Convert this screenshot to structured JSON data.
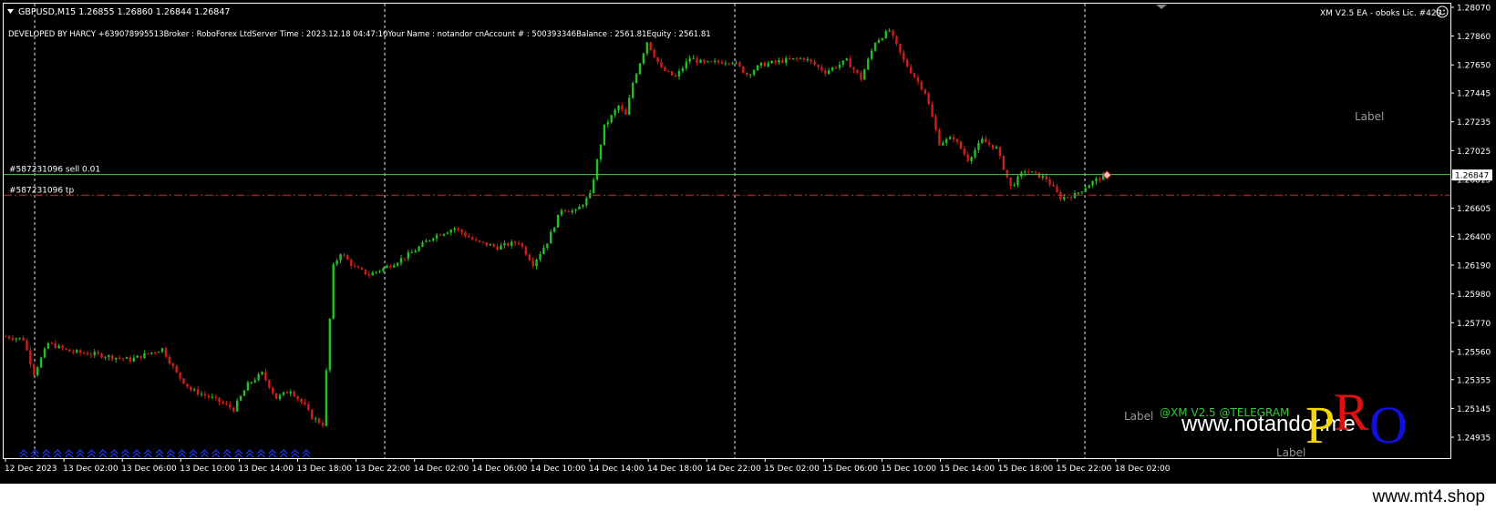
{
  "header": {
    "symbol_line": "GBPUSD,M15  1.26855 1.26860 1.26844 1.26847",
    "info_line": "DEVELOPED BY HARCY +639078995513Broker   : RoboForex LtdServer Time : 2023.12.18 04:47:10Your Name     : notandor cnAccount #   : 500393346Balance : 2561.81Equity     : 2561.81",
    "ea_label": "XM V2.5 EA - oboks Lic. #429"
  },
  "chart_labels": {
    "label1": "Label",
    "label2": "Label",
    "label3": "Label",
    "telegram": "@XM V2.5 @TELEGRAM",
    "website": "www.notandor.me",
    "logo_p": "P",
    "logo_r": "R",
    "logo_o": "O"
  },
  "orders": {
    "sell_label": "#587231096 sell 0.01",
    "tp_label": "#587231096 tp"
  },
  "footer": {
    "url": "www.mt4.shop"
  },
  "colors": {
    "background": "#000000",
    "bull": "#21c121",
    "bear": "#d41a1a",
    "grid": "#ffffff",
    "order_line": "#5fbf5f",
    "tp_line": "#c23030",
    "arrows": "#1e3cff"
  },
  "chart_data": {
    "type": "candlestick",
    "symbol": "GBPUSD",
    "timeframe": "M15",
    "current_price": "1.26847",
    "yticks": [
      "1.28070",
      "1.27860",
      "1.27650",
      "1.27445",
      "1.27235",
      "1.27025",
      "1.26815",
      "1.26605",
      "1.26400",
      "1.26190",
      "1.25980",
      "1.25770",
      "1.25560",
      "1.25355",
      "1.25145",
      "1.24935"
    ],
    "ylim": [
      1.24935,
      1.2807
    ],
    "xticks": [
      "12 Dec 2023",
      "13 Dec 02:00",
      "13 Dec 06:00",
      "13 Dec 10:00",
      "13 Dec 14:00",
      "13 Dec 18:00",
      "13 Dec 22:00",
      "14 Dec 02:00",
      "14 Dec 06:00",
      "14 Dec 10:00",
      "14 Dec 14:00",
      "14 Dec 18:00",
      "14 Dec 22:00",
      "15 Dec 02:00",
      "15 Dec 06:00",
      "15 Dec 10:00",
      "15 Dec 14:00",
      "15 Dec 18:00",
      "15 Dec 22:00",
      "18 Dec 02:00"
    ],
    "sell_price": 1.2685,
    "tp_price": 1.267,
    "close_path": [
      [
        0,
        1.2567
      ],
      [
        5,
        1.2565
      ],
      [
        8,
        1.254
      ],
      [
        12,
        1.2562
      ],
      [
        18,
        1.2556
      ],
      [
        25,
        1.2554
      ],
      [
        35,
        1.255
      ],
      [
        44,
        1.2558
      ],
      [
        48,
        1.254
      ],
      [
        52,
        1.2528
      ],
      [
        58,
        1.2522
      ],
      [
        64,
        1.2514
      ],
      [
        68,
        1.2532
      ],
      [
        72,
        1.254
      ],
      [
        76,
        1.2522
      ],
      [
        80,
        1.2528
      ],
      [
        84,
        1.2516
      ],
      [
        86,
        1.2508
      ],
      [
        89,
        1.2503
      ],
      [
        92,
        1.2618
      ],
      [
        94,
        1.2628
      ],
      [
        98,
        1.2617
      ],
      [
        102,
        1.2612
      ],
      [
        108,
        1.2619
      ],
      [
        114,
        1.2628
      ],
      [
        120,
        1.264
      ],
      [
        126,
        1.2646
      ],
      [
        132,
        1.2636
      ],
      [
        138,
        1.2632
      ],
      [
        144,
        1.2636
      ],
      [
        148,
        1.262
      ],
      [
        152,
        1.2636
      ],
      [
        156,
        1.266
      ],
      [
        160,
        1.2658
      ],
      [
        164,
        1.267
      ],
      [
        168,
        1.272
      ],
      [
        172,
        1.2735
      ],
      [
        174,
        1.2728
      ],
      [
        176,
        1.2752
      ],
      [
        180,
        1.2782
      ],
      [
        184,
        1.2762
      ],
      [
        188,
        1.2756
      ],
      [
        192,
        1.277
      ],
      [
        196,
        1.2766
      ],
      [
        204,
        1.2768
      ],
      [
        208,
        1.2758
      ],
      [
        212,
        1.2765
      ],
      [
        218,
        1.2768
      ],
      [
        224,
        1.277
      ],
      [
        230,
        1.276
      ],
      [
        236,
        1.2768
      ],
      [
        240,
        1.2755
      ],
      [
        244,
        1.2782
      ],
      [
        248,
        1.279
      ],
      [
        252,
        1.2768
      ],
      [
        258,
        1.2745
      ],
      [
        262,
        1.2708
      ],
      [
        266,
        1.2712
      ],
      [
        270,
        1.2696
      ],
      [
        274,
        1.271
      ],
      [
        278,
        1.2704
      ],
      [
        282,
        1.2676
      ],
      [
        286,
        1.2688
      ],
      [
        292,
        1.2682
      ],
      [
        296,
        1.2668
      ],
      [
        300,
        1.267
      ],
      [
        304,
        1.2678
      ],
      [
        308,
        1.2684
      ]
    ]
  }
}
